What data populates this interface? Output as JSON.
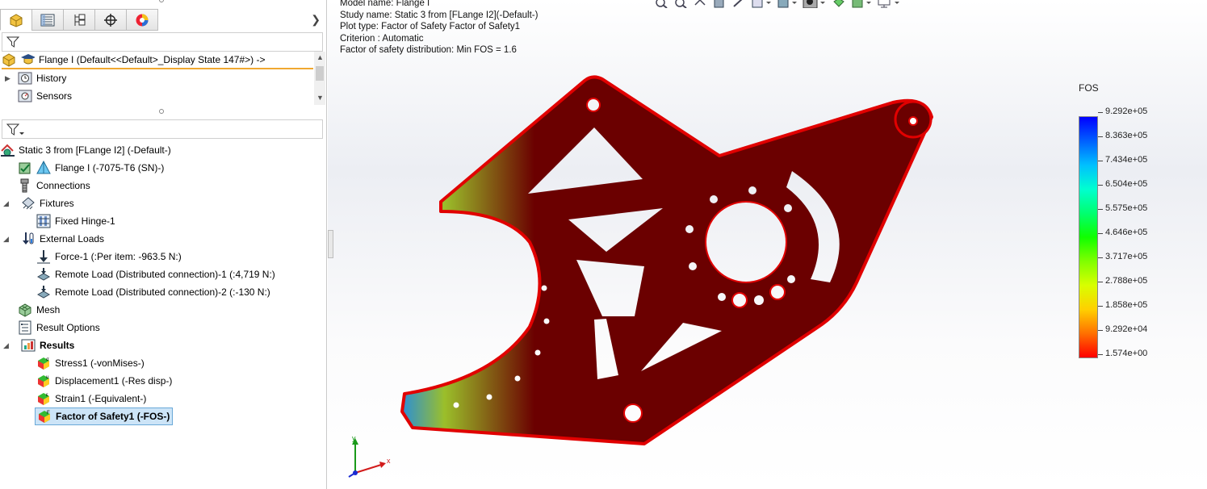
{
  "tabs": [
    {
      "name": "feature-manager-tab",
      "icon": "feature-manager-icon",
      "active": true
    },
    {
      "name": "property-manager-tab",
      "icon": "property-manager-icon"
    },
    {
      "name": "configuration-manager-tab",
      "icon": "configuration-manager-icon"
    },
    {
      "name": "dimxpert-tab",
      "icon": "dimxpert-icon"
    },
    {
      "name": "display-manager-tab",
      "icon": "display-manager-icon"
    }
  ],
  "model_tree": {
    "root_label": "Flange I  (Default<<Default>_Display State 147#>) ->",
    "items": [
      {
        "label": "History"
      },
      {
        "label": "Sensors"
      }
    ]
  },
  "study_tree": {
    "root_label": "Static 3 from [FLange I2] (-Default-)",
    "part_label": "Flange I (-7075-T6 (SN)-)",
    "connections_label": "Connections",
    "fixtures_label": "Fixtures",
    "fixed_hinge_label": "Fixed Hinge-1",
    "external_loads_label": "External Loads",
    "force_label": "Force-1 (:Per item: -963.5 N:)",
    "remote1_label": "Remote Load (Distributed connection)-1 (:4,719 N:)",
    "remote2_label": "Remote Load (Distributed connection)-2 (:-130 N:)",
    "mesh_label": "Mesh",
    "result_options_label": "Result Options",
    "results_label": "Results",
    "stress_label": "Stress1 (-vonMises-)",
    "displacement_label": "Displacement1 (-Res disp-)",
    "strain_label": "Strain1 (-Equivalent-)",
    "fos_label": "Factor of Safety1 (-FOS-)"
  },
  "viewport": {
    "model_name": "Model name: Flange I",
    "study_name": "Study name: Static 3 from [FLange I2](-Default-)",
    "plot_type": "Plot type: Factor of Safety Factor of Safety1",
    "criterion": "Criterion : Automatic",
    "distribution": "Factor of safety distribution: Min FOS = 1.6"
  },
  "legend": {
    "title": "FOS",
    "ticks": [
      "9.292e+05",
      "8.363e+05",
      "7.434e+05",
      "6.504e+05",
      "5.575e+05",
      "4.646e+05",
      "3.717e+05",
      "2.788e+05",
      "1.858e+05",
      "9.292e+04",
      "1.574e+00"
    ]
  },
  "triad": {
    "x": "x",
    "y": "y"
  },
  "colors": {
    "part": "#6b0000",
    "edge": "#e00000",
    "selection": "#cce4f7",
    "accent_line": "#f0a830"
  }
}
